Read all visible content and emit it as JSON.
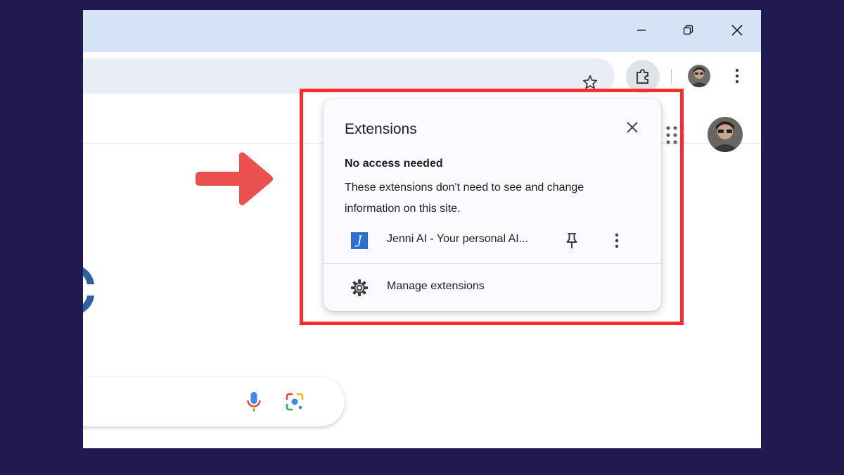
{
  "window": {
    "controls": [
      "minimize-icon",
      "restore-icon",
      "close-icon"
    ]
  },
  "toolbar": {
    "icons": [
      "star-icon",
      "puzzle-icon",
      "avatar",
      "kebab-menu-icon"
    ]
  },
  "popup": {
    "title": "Extensions",
    "section_title": "No access needed",
    "section_description": "These extensions don't need to see and change information on this site.",
    "extensions": [
      {
        "name": "Jenni AI - Your personal AI...",
        "logo_letter": "J"
      }
    ],
    "manage_label": "Manage extensions"
  },
  "colors": {
    "background": "#201a50",
    "titlebar": "#d6e3f7",
    "omnibox": "#e9eef6",
    "highlight_border": "#ff2a2a",
    "arrow": "#e9504e",
    "extension_logo": "#2b6fd4"
  }
}
